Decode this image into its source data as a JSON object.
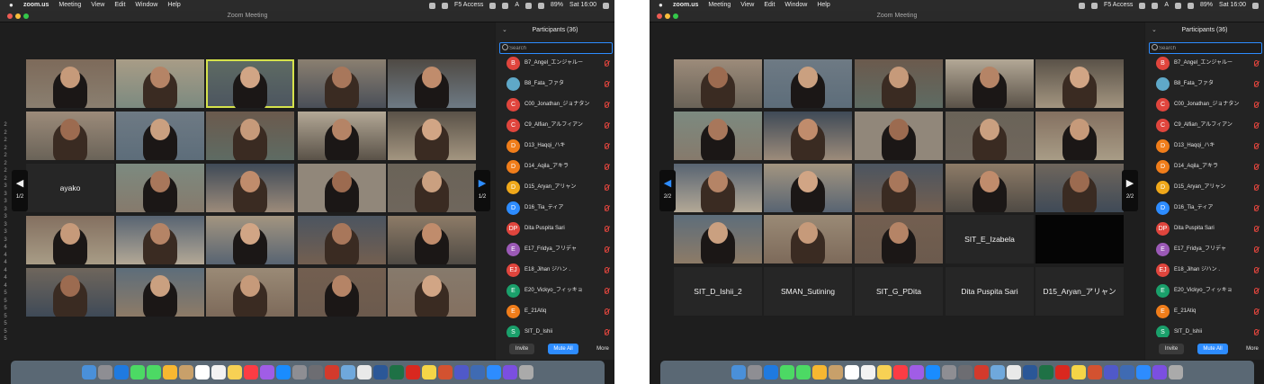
{
  "left": {
    "menubar": {
      "apple": "",
      "app_name": "zoom.us",
      "menus": [
        "Meeting",
        "View",
        "Edit",
        "Window",
        "Help"
      ],
      "vpn": "F5 Access",
      "badge": "A",
      "battery": "89%",
      "clock": "Sat 16:00"
    },
    "window_title": "Zoom Meeting",
    "gallery": {
      "name_tile": "ayako",
      "nav_right_page": "1/2",
      "nav_left_page": "1/2",
      "gutter_numbers": [
        "2",
        "2",
        "2",
        "2",
        "2",
        "2",
        "2",
        "2",
        "3",
        "3",
        "3",
        "3",
        "3",
        "3",
        "3",
        "3",
        "4",
        "4",
        "4",
        "4",
        "4",
        "4",
        "5",
        "5",
        "5",
        "5",
        "5",
        "5",
        "5"
      ]
    },
    "participants": {
      "header": "Participants (36)",
      "search_placeholder": "Search",
      "items": [
        {
          "initials": "B",
          "name": "B7_Angel_エンジャルー",
          "color": "#e0453d"
        },
        {
          "initials": "",
          "name": "B8_Fata_ファタ",
          "color": "#5fa8c8"
        },
        {
          "initials": "C",
          "name": "C00_Jonathan_ジョナタン",
          "color": "#e0453d"
        },
        {
          "initials": "C",
          "name": "C9_Alfian_アルフィアン",
          "color": "#e0453d"
        },
        {
          "initials": "D",
          "name": "D13_Haqqi_ハキ",
          "color": "#f07d1a"
        },
        {
          "initials": "D",
          "name": "D14_Aqila_アキラ",
          "color": "#f07d1a"
        },
        {
          "initials": "D",
          "name": "D15_Aryan_アリャン",
          "color": "#f0a81a"
        },
        {
          "initials": "D",
          "name": "D16_Tia_ティア",
          "color": "#2d8cff"
        },
        {
          "initials": "DP",
          "name": "Dita Puspita Sari",
          "color": "#e0453d"
        },
        {
          "initials": "E",
          "name": "E17_Fridya_フリデャ",
          "color": "#9b59b6"
        },
        {
          "initials": "EJ",
          "name": "E18_Jihan ジハン .",
          "color": "#e0453d"
        },
        {
          "initials": "E",
          "name": "E20_Vickyo_フィッキョ",
          "color": "#1aa06b"
        },
        {
          "initials": "E",
          "name": "E_21Atiq",
          "color": "#f07d1a"
        },
        {
          "initials": "S",
          "name": "SIT_D_Ishii",
          "color": "#1aa06b"
        }
      ],
      "invite": "Invite",
      "mute_all": "Mute All",
      "more": "More"
    }
  },
  "right": {
    "menubar": {
      "apple": "",
      "app_name": "zoom.us",
      "menus": [
        "Meeting",
        "View",
        "Edit",
        "Window",
        "Help"
      ],
      "vpn": "F5 Access",
      "badge": "A",
      "battery": "89%",
      "clock": "Sat 16:00"
    },
    "window_title": "Zoom Meeting",
    "gallery": {
      "name_tiles": [
        "SIT_E_Izabela",
        "SIT_D_Ishii_2",
        "SMAN_Sutining",
        "SIT_G_PDita",
        "Dita Puspita Sari",
        "D15_Aryan_アリャン"
      ],
      "nav_left_page": "2/2",
      "nav_right_page": "2/2"
    },
    "participants": {
      "header": "Participants (36)",
      "search_placeholder": "Search",
      "items": [
        {
          "initials": "B",
          "name": "B7_Angel_エンジャルー",
          "color": "#e0453d"
        },
        {
          "initials": "",
          "name": "B8_Fata_ファタ",
          "color": "#5fa8c8"
        },
        {
          "initials": "C",
          "name": "C00_Jonathan_ジョナタン",
          "color": "#e0453d"
        },
        {
          "initials": "C",
          "name": "C9_Alfian_アルフィアン",
          "color": "#e0453d"
        },
        {
          "initials": "D",
          "name": "D13_Haqqi_ハキ",
          "color": "#f07d1a"
        },
        {
          "initials": "D",
          "name": "D14_Aqila_アキラ",
          "color": "#f07d1a"
        },
        {
          "initials": "D",
          "name": "D15_Aryan_アリャン",
          "color": "#f0a81a"
        },
        {
          "initials": "D",
          "name": "D16_Tia_ティア",
          "color": "#2d8cff"
        },
        {
          "initials": "DP",
          "name": "Dita Puspita Sari",
          "color": "#e0453d"
        },
        {
          "initials": "E",
          "name": "E17_Fridya_フリデャ",
          "color": "#9b59b6"
        },
        {
          "initials": "EJ",
          "name": "E18_Jihan ジハン .",
          "color": "#e0453d"
        },
        {
          "initials": "E",
          "name": "E20_Vickyo_フィッキョ",
          "color": "#1aa06b"
        },
        {
          "initials": "E",
          "name": "E_21Atiq",
          "color": "#f07d1a"
        },
        {
          "initials": "S",
          "name": "SIT_D_Ishii",
          "color": "#1aa06b"
        }
      ],
      "invite": "Invite",
      "mute_all": "Mute All",
      "more": "More"
    }
  },
  "dock_icons": [
    "finder-icon",
    "launchpad-icon",
    "safari-icon",
    "messages-icon",
    "facetime-icon",
    "photos-icon",
    "contacts-icon",
    "calendar-icon",
    "reminders-icon",
    "notes-icon",
    "music-icon",
    "podcasts-icon",
    "app-store-icon",
    "system-preferences-icon",
    "dictionary-icon",
    "settings-icon",
    "preview-icon",
    "chrome-icon",
    "word-icon",
    "excel-icon",
    "acrobat-icon",
    "stickies-icon",
    "powerpoint-icon",
    "teams-icon",
    "photo-icon",
    "zoom-icon",
    "imovie-icon",
    "trash-icon"
  ]
}
